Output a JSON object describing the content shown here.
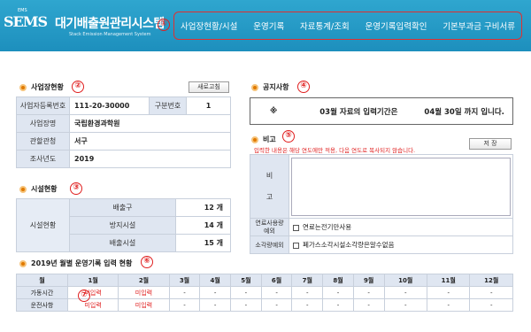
{
  "header": {
    "logo_small": "EMS",
    "logo_sems": "SEMS",
    "title": "대기배출원관리시스템",
    "subtitle": "Stack Emission Management System",
    "nav": [
      "사업장현황/시설",
      "운영기록",
      "자료통계/조회",
      "운영기록입력확인",
      "기본부과금 구비서류"
    ]
  },
  "badges": [
    "①",
    "②",
    "③",
    "④",
    "⑤",
    "⑥",
    "⑦"
  ],
  "site": {
    "title": "사업장현황",
    "refresh_label": "새로고침",
    "reg_no_label": "사업자등록번호",
    "reg_no": "111-20-30000",
    "class_label": "구분번호",
    "class_no": "1",
    "name_label": "사업장명",
    "name": "국립환경과학원",
    "office_label": "관할관청",
    "office": "서구",
    "year_label": "조사년도",
    "year": "2019"
  },
  "facility": {
    "title": "시설현황",
    "group_label": "시설현황",
    "rows": [
      {
        "label": "배출구",
        "value": "12 개"
      },
      {
        "label": "방지시설",
        "value": "14 개"
      },
      {
        "label": "배출시설",
        "value": "15 개"
      }
    ]
  },
  "notice": {
    "title": "공지사항",
    "star": "※",
    "text1": "03월 자료의 입력기간은",
    "text2": "04월 30일 까지 입니다."
  },
  "remarks": {
    "title": "비고",
    "save_label": "저 장",
    "warning": "입력한 내용은 해당 연도에만 적용, 다음 연도로 복사되지 않습니다.",
    "remark_label_1": "비",
    "remark_label_2": "고",
    "fuel_label_1": "연료사용량",
    "fuel_label_2": "예외",
    "fuel_option": "연료는전기만사용",
    "incin_label": "소각량예외",
    "incin_option": "폐가스소각시설소각량은알수없음"
  },
  "monthly": {
    "title": "2019년 월별 운영기록 입력 현황",
    "header": [
      "월",
      "1월",
      "2월",
      "3월",
      "4월",
      "5월",
      "6월",
      "7월",
      "8월",
      "9월",
      "10월",
      "11월",
      "12월"
    ],
    "rows": [
      {
        "label": "가동시간",
        "cells": [
          "미입력",
          "미입력",
          "-",
          "-",
          "-",
          "-",
          "-",
          "-",
          "-",
          "-",
          "-",
          "-"
        ]
      },
      {
        "label": "운전사항",
        "cells": [
          "미입력",
          "미입력",
          "-",
          "-",
          "-",
          "-",
          "-",
          "-",
          "-",
          "-",
          "-",
          "-"
        ]
      }
    ]
  },
  "colors": {
    "header_bg": "#2fa6cf",
    "label_bg": "#dfe6f1",
    "alert": "#e02020",
    "bullet": "#e07a00"
  }
}
